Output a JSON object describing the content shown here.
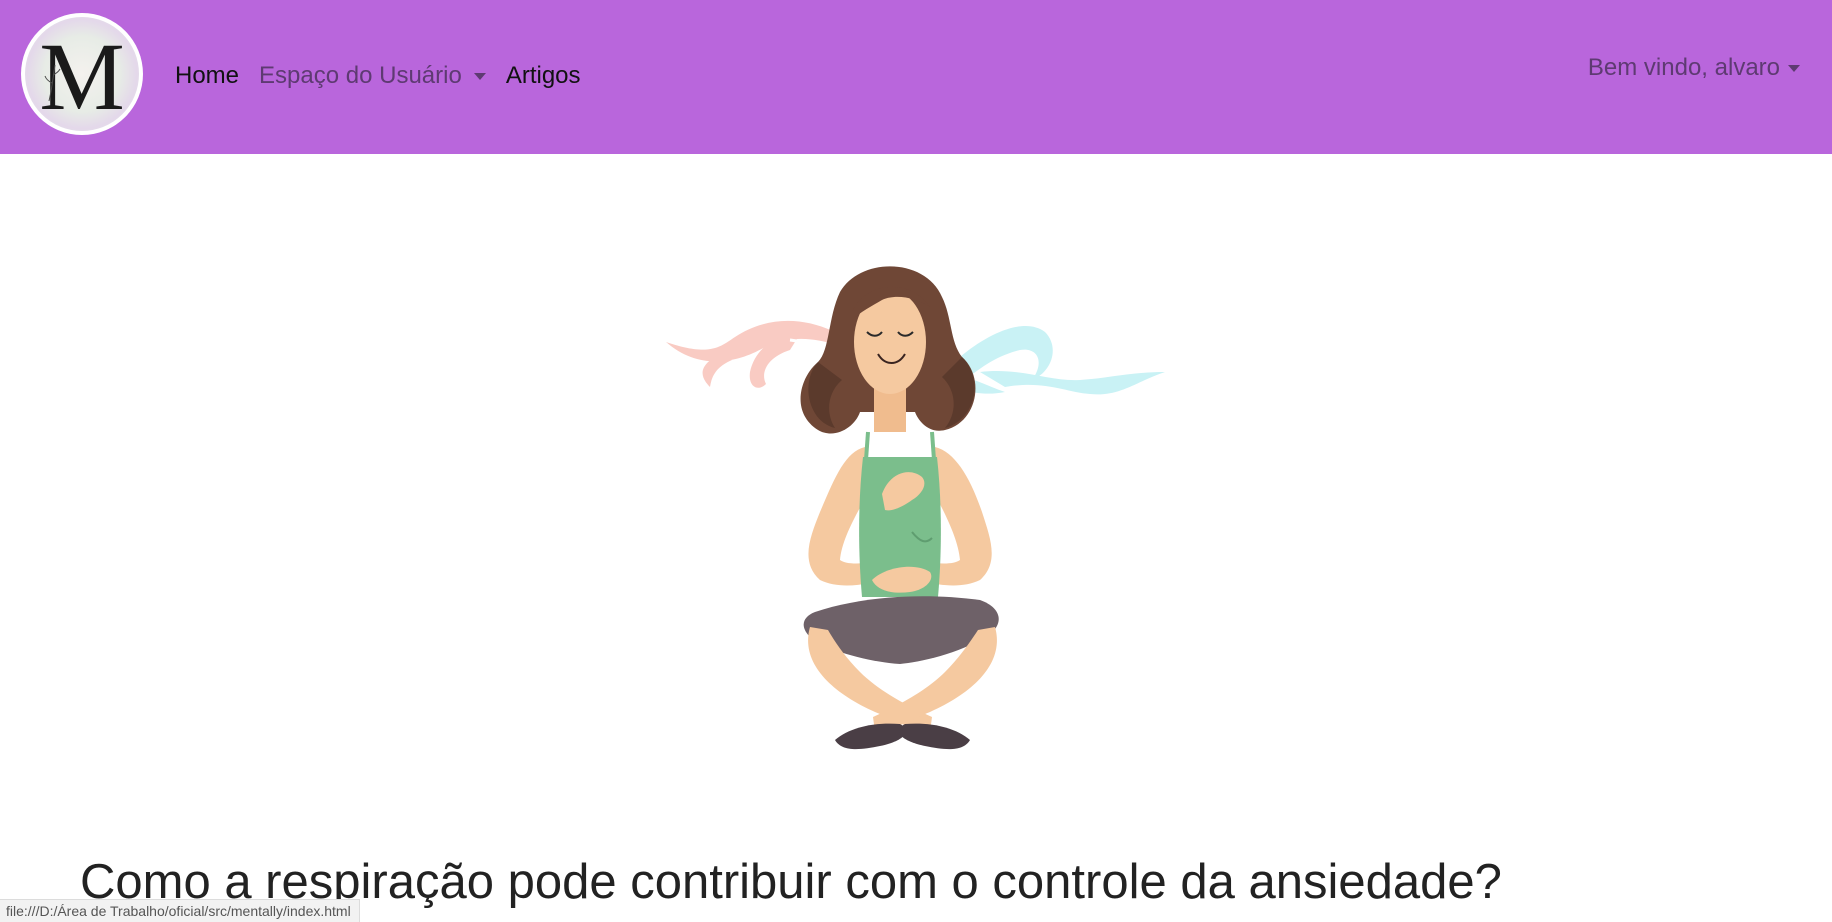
{
  "brand": {
    "logo_letter": "M",
    "logo_signature": "Mentally"
  },
  "nav": {
    "items": [
      {
        "label": "Home",
        "state": "active",
        "has_dropdown": false
      },
      {
        "label": "Espaço do Usuário",
        "state": "muted",
        "has_dropdown": true
      },
      {
        "label": "Artigos",
        "state": "active",
        "has_dropdown": false
      }
    ]
  },
  "user_menu": {
    "label": "Bem vindo, alvaro"
  },
  "hero": {
    "icon": "meditating-woman-breathing-illustration"
  },
  "article": {
    "title": "Como a respiração pode contribuir com o controle da ansiedade?"
  },
  "status_bar": {
    "url": "file:///D:/Área de Trabalho/oficial/src/mentally/index.html"
  },
  "colors": {
    "navbar_bg": "#b966dc",
    "nav_active": "#111111",
    "nav_muted": "#5e3a72",
    "title_text": "#222222",
    "breath_out": "#f9c7c0",
    "breath_in": "#c9f3f6",
    "shirt": "#7bbe8c",
    "hair": "#6f4736",
    "skin": "#f5c9a0",
    "pants": "#6e6168"
  }
}
